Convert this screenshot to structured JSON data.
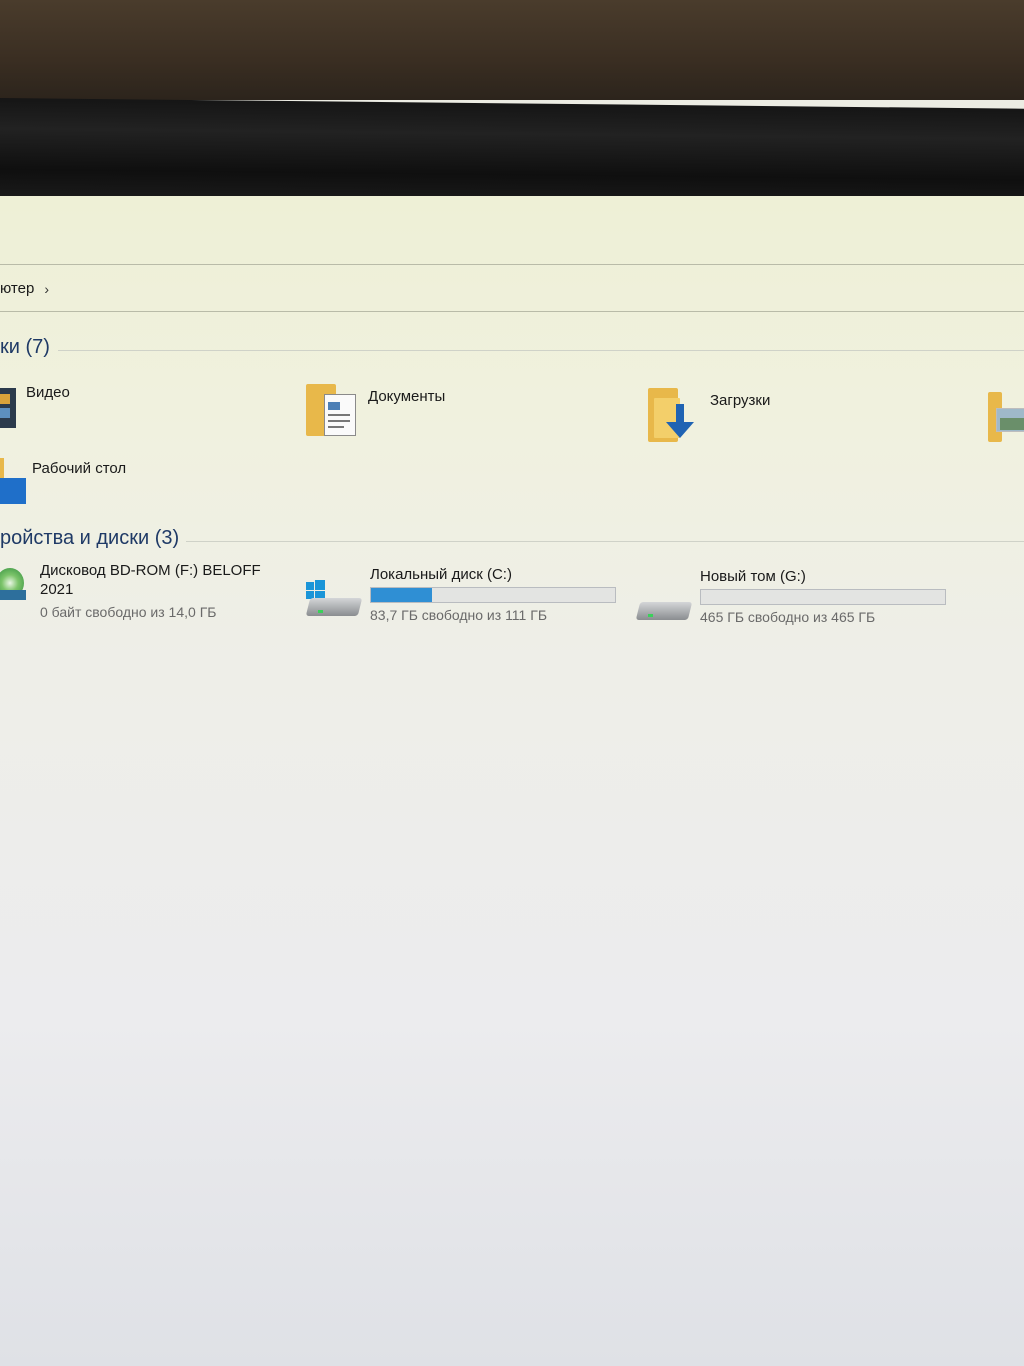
{
  "breadcrumb": {
    "partial_label": "ютер",
    "chevron": "›"
  },
  "folders_group": {
    "title": "ки (7)"
  },
  "folders": [
    {
      "label": "Видео",
      "icon": "video-folder-icon"
    },
    {
      "label": "Документы",
      "icon": "documents-folder-icon"
    },
    {
      "label": "Загрузки",
      "icon": "downloads-folder-icon"
    },
    {
      "label": "",
      "icon": "pictures-folder-icon"
    },
    {
      "label": "Рабочий стол",
      "icon": "desktop-folder-icon"
    }
  ],
  "drives_group": {
    "title": "ройства и диски (3)"
  },
  "drives": [
    {
      "name_line1": "Дисковод BD-ROM (F:) BELOFF",
      "name_line2": "2021",
      "sub": "0 байт свободно из 14,0 ГБ",
      "icon": "optical-drive-icon"
    },
    {
      "name": "Локальный диск (C:)",
      "sub": "83,7 ГБ свободно из 111 ГБ",
      "used_fraction": 0.25,
      "icon": "system-drive-icon"
    },
    {
      "name": "Новый том (G:)",
      "sub": "465 ГБ свободно из 465 ГБ",
      "used_fraction": 0.0,
      "icon": "hard-drive-icon"
    }
  ]
}
